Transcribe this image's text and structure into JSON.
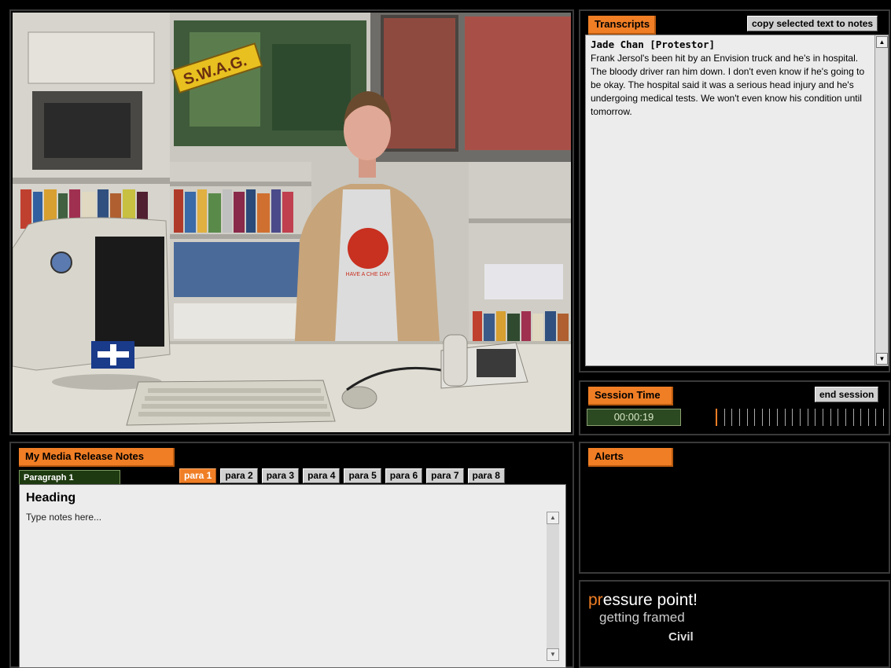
{
  "transcripts": {
    "title": "Transcripts",
    "copy_button": "copy selected text to notes",
    "speaker": "Jade Chan [Protestor]",
    "text": "Frank Jersol's been hit by an Envision truck and he's in hospital. The bloody driver ran him down.  I don't even know if he's going to be okay.  The hospital said it was a serious head injury and he's undergoing medical tests. We won't even know his condition until tomorrow."
  },
  "session": {
    "title": "Session Time",
    "end_button": "end session",
    "time": "00:00:19"
  },
  "alerts": {
    "title": "Alerts"
  },
  "brand": {
    "line1_accent": "pr",
    "line1_rest": "essure point!",
    "line2": "getting framed",
    "line3": "Civil"
  },
  "notes": {
    "title": "My Media Release Notes",
    "paragraph_tab": "Paragraph 1",
    "paras": [
      "para 1",
      "para 2",
      "para 3",
      "para 4",
      "para 5",
      "para 6",
      "para 7",
      "para 8"
    ],
    "active_para": 0,
    "heading": "Heading",
    "placeholder": "Type notes here..."
  },
  "video": {
    "sign_text": "S.W.A.G.",
    "shirt_text": "HAVE A CHE DAY"
  },
  "colors": {
    "accent": "#f07e25",
    "panel_border": "#3a3a3a",
    "time_bg": "#2c4a22"
  },
  "icons": {
    "scroll_up": "up-arrow-icon",
    "scroll_down": "down-arrow-icon"
  }
}
